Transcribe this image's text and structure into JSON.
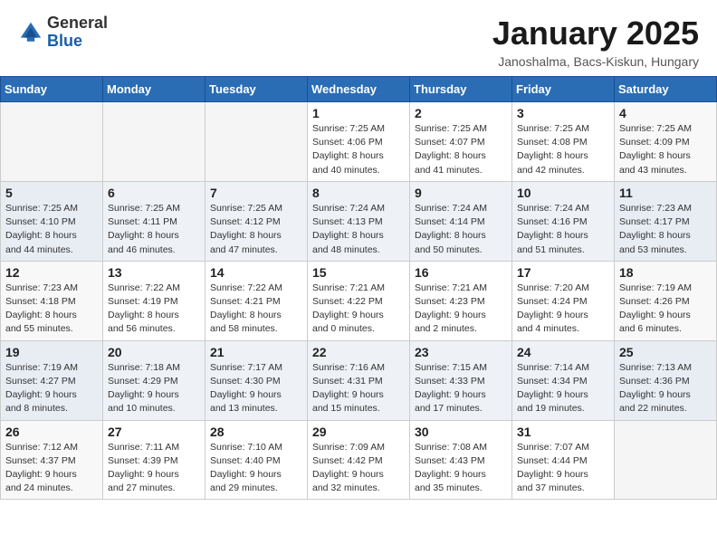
{
  "header": {
    "logo_general": "General",
    "logo_blue": "Blue",
    "month_title": "January 2025",
    "location": "Janoshalma, Bacs-Kiskun, Hungary"
  },
  "days_of_week": [
    "Sunday",
    "Monday",
    "Tuesday",
    "Wednesday",
    "Thursday",
    "Friday",
    "Saturday"
  ],
  "weeks": [
    [
      {
        "day": "",
        "info": ""
      },
      {
        "day": "",
        "info": ""
      },
      {
        "day": "",
        "info": ""
      },
      {
        "day": "1",
        "info": "Sunrise: 7:25 AM\nSunset: 4:06 PM\nDaylight: 8 hours\nand 40 minutes."
      },
      {
        "day": "2",
        "info": "Sunrise: 7:25 AM\nSunset: 4:07 PM\nDaylight: 8 hours\nand 41 minutes."
      },
      {
        "day": "3",
        "info": "Sunrise: 7:25 AM\nSunset: 4:08 PM\nDaylight: 8 hours\nand 42 minutes."
      },
      {
        "day": "4",
        "info": "Sunrise: 7:25 AM\nSunset: 4:09 PM\nDaylight: 8 hours\nand 43 minutes."
      }
    ],
    [
      {
        "day": "5",
        "info": "Sunrise: 7:25 AM\nSunset: 4:10 PM\nDaylight: 8 hours\nand 44 minutes."
      },
      {
        "day": "6",
        "info": "Sunrise: 7:25 AM\nSunset: 4:11 PM\nDaylight: 8 hours\nand 46 minutes."
      },
      {
        "day": "7",
        "info": "Sunrise: 7:25 AM\nSunset: 4:12 PM\nDaylight: 8 hours\nand 47 minutes."
      },
      {
        "day": "8",
        "info": "Sunrise: 7:24 AM\nSunset: 4:13 PM\nDaylight: 8 hours\nand 48 minutes."
      },
      {
        "day": "9",
        "info": "Sunrise: 7:24 AM\nSunset: 4:14 PM\nDaylight: 8 hours\nand 50 minutes."
      },
      {
        "day": "10",
        "info": "Sunrise: 7:24 AM\nSunset: 4:16 PM\nDaylight: 8 hours\nand 51 minutes."
      },
      {
        "day": "11",
        "info": "Sunrise: 7:23 AM\nSunset: 4:17 PM\nDaylight: 8 hours\nand 53 minutes."
      }
    ],
    [
      {
        "day": "12",
        "info": "Sunrise: 7:23 AM\nSunset: 4:18 PM\nDaylight: 8 hours\nand 55 minutes."
      },
      {
        "day": "13",
        "info": "Sunrise: 7:22 AM\nSunset: 4:19 PM\nDaylight: 8 hours\nand 56 minutes."
      },
      {
        "day": "14",
        "info": "Sunrise: 7:22 AM\nSunset: 4:21 PM\nDaylight: 8 hours\nand 58 minutes."
      },
      {
        "day": "15",
        "info": "Sunrise: 7:21 AM\nSunset: 4:22 PM\nDaylight: 9 hours\nand 0 minutes."
      },
      {
        "day": "16",
        "info": "Sunrise: 7:21 AM\nSunset: 4:23 PM\nDaylight: 9 hours\nand 2 minutes."
      },
      {
        "day": "17",
        "info": "Sunrise: 7:20 AM\nSunset: 4:24 PM\nDaylight: 9 hours\nand 4 minutes."
      },
      {
        "day": "18",
        "info": "Sunrise: 7:19 AM\nSunset: 4:26 PM\nDaylight: 9 hours\nand 6 minutes."
      }
    ],
    [
      {
        "day": "19",
        "info": "Sunrise: 7:19 AM\nSunset: 4:27 PM\nDaylight: 9 hours\nand 8 minutes."
      },
      {
        "day": "20",
        "info": "Sunrise: 7:18 AM\nSunset: 4:29 PM\nDaylight: 9 hours\nand 10 minutes."
      },
      {
        "day": "21",
        "info": "Sunrise: 7:17 AM\nSunset: 4:30 PM\nDaylight: 9 hours\nand 13 minutes."
      },
      {
        "day": "22",
        "info": "Sunrise: 7:16 AM\nSunset: 4:31 PM\nDaylight: 9 hours\nand 15 minutes."
      },
      {
        "day": "23",
        "info": "Sunrise: 7:15 AM\nSunset: 4:33 PM\nDaylight: 9 hours\nand 17 minutes."
      },
      {
        "day": "24",
        "info": "Sunrise: 7:14 AM\nSunset: 4:34 PM\nDaylight: 9 hours\nand 19 minutes."
      },
      {
        "day": "25",
        "info": "Sunrise: 7:13 AM\nSunset: 4:36 PM\nDaylight: 9 hours\nand 22 minutes."
      }
    ],
    [
      {
        "day": "26",
        "info": "Sunrise: 7:12 AM\nSunset: 4:37 PM\nDaylight: 9 hours\nand 24 minutes."
      },
      {
        "day": "27",
        "info": "Sunrise: 7:11 AM\nSunset: 4:39 PM\nDaylight: 9 hours\nand 27 minutes."
      },
      {
        "day": "28",
        "info": "Sunrise: 7:10 AM\nSunset: 4:40 PM\nDaylight: 9 hours\nand 29 minutes."
      },
      {
        "day": "29",
        "info": "Sunrise: 7:09 AM\nSunset: 4:42 PM\nDaylight: 9 hours\nand 32 minutes."
      },
      {
        "day": "30",
        "info": "Sunrise: 7:08 AM\nSunset: 4:43 PM\nDaylight: 9 hours\nand 35 minutes."
      },
      {
        "day": "31",
        "info": "Sunrise: 7:07 AM\nSunset: 4:44 PM\nDaylight: 9 hours\nand 37 minutes."
      },
      {
        "day": "",
        "info": ""
      }
    ]
  ]
}
